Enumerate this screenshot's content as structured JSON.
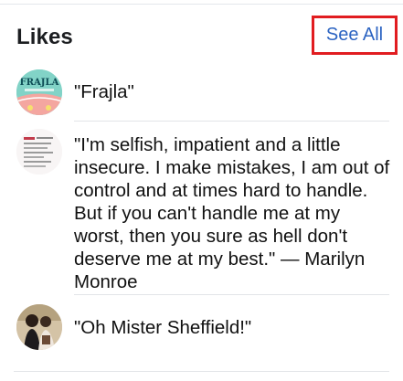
{
  "likes": {
    "title": "Likes",
    "see_all_label": "See All",
    "items": [
      {
        "text": "\"Frajla\"",
        "avatar_text": "FRAJLA",
        "avatar_color": "#7ed0c6"
      },
      {
        "text": "\"I'm selfish, impatient and a little insecure. I make mistakes, I am out of control and at times hard to handle. But if you can't handle me at my worst, then you sure as hell don't deserve me at my best.\"  — Marilyn Monroe",
        "avatar_color": "#f7f4f4"
      },
      {
        "text": "\"Oh Mister Sheffield!\"",
        "avatar_color": "#c9b59a"
      }
    ]
  },
  "colors": {
    "link": "#2c64c2",
    "highlight_border": "#e11d20",
    "divider": "#e2e4e8"
  }
}
